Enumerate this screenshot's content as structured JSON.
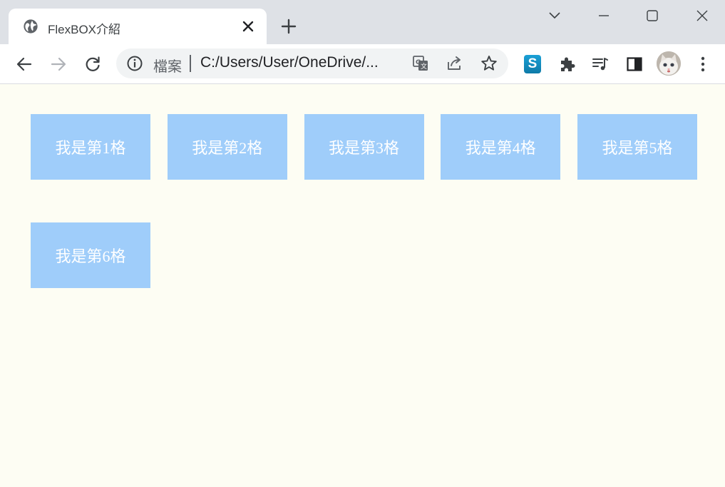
{
  "browser": {
    "tab": {
      "title": "FlexBOX介紹",
      "favicon": "globe-icon"
    },
    "address_bar": {
      "scheme_label": "檔案",
      "url": "C:/Users/User/OneDrive/..."
    },
    "extensions": {
      "skype_letter": "S"
    }
  },
  "page": {
    "boxes": [
      {
        "label": "我是第1格"
      },
      {
        "label": "我是第2格"
      },
      {
        "label": "我是第3格"
      },
      {
        "label": "我是第4格"
      },
      {
        "label": "我是第5格"
      },
      {
        "label": "我是第6格"
      }
    ],
    "colors": {
      "box_background": "#9fcdfa",
      "box_text": "#ffffff",
      "page_background": "#fdfdf3"
    }
  }
}
